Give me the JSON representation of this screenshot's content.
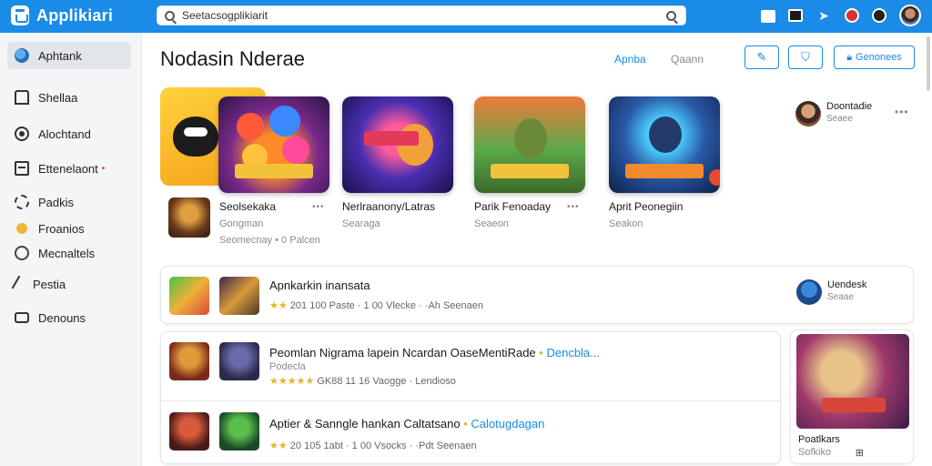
{
  "app": {
    "name": "Applikiari"
  },
  "search": {
    "value": "Seetacsogplikiarit"
  },
  "sidebar": {
    "items": [
      {
        "label": "Aphtank",
        "icon": "globe-icon"
      },
      {
        "label": "Shellaa",
        "icon": "home-icon"
      },
      {
        "label": "Alochtand",
        "icon": "circle-icon"
      },
      {
        "label": "Ettenelaont",
        "icon": "box-icon",
        "badge": "•"
      },
      {
        "label": "Padkis",
        "icon": "gear-icon"
      },
      {
        "label": "Froanios",
        "icon": "coin-icon"
      },
      {
        "label": "Mecnaltels",
        "icon": "ring-icon"
      },
      {
        "label": "Pestia",
        "icon": "pen-icon"
      },
      {
        "label": "Denouns",
        "icon": "camera-icon"
      }
    ]
  },
  "header": {
    "title": "Nodasin Nderae",
    "tab_a": "Apnba",
    "tab_b": "Qaann",
    "primary_button": "Genonees"
  },
  "featured": [
    {
      "title": "Seolsekaka",
      "sub": "Gongman",
      "sub2": "Seomecnay  •  0  Palcen"
    },
    {
      "title": "Nerlraanony/Latras",
      "sub": "Searaga"
    },
    {
      "title": "Parik Fenoaday",
      "sub": "Seaeon"
    },
    {
      "title": "Aprit Peonegiin",
      "sub": "Seakon"
    }
  ],
  "right_user": {
    "name": "Doontadie",
    "sub": "Seaee"
  },
  "list": {
    "row1": {
      "title": "Apnkarkin inansata",
      "stars": "★★",
      "meta": "201  100  Paste  ·  1 00  Vlecke  ·  ·Ah Seenaen",
      "user": "Uendesk",
      "user_sub": "Seaae"
    },
    "row2": {
      "title": "Peomlan Nigrama lapein Ncardan OaseMentiRade",
      "link": "Dencbla...",
      "sub": "Podecla",
      "stars": "★★★★★",
      "meta": "GK88  11 16  Vaogge  ·  Lendioso"
    },
    "row3": {
      "title": "Aptier & Sanngle hankan Caltatsano",
      "link": "Calotugdagan",
      "stars": "★★",
      "meta": "20 105 1abt  ·  1 00  Vsocks  ·  ·Pdt Seenaen"
    },
    "side_card": {
      "title": "Poatlkars",
      "sub": "Sofkiko"
    }
  },
  "colors": {
    "accent": "#1a8be6",
    "topbar": "#1a8be6",
    "star": "#e8b22a"
  }
}
